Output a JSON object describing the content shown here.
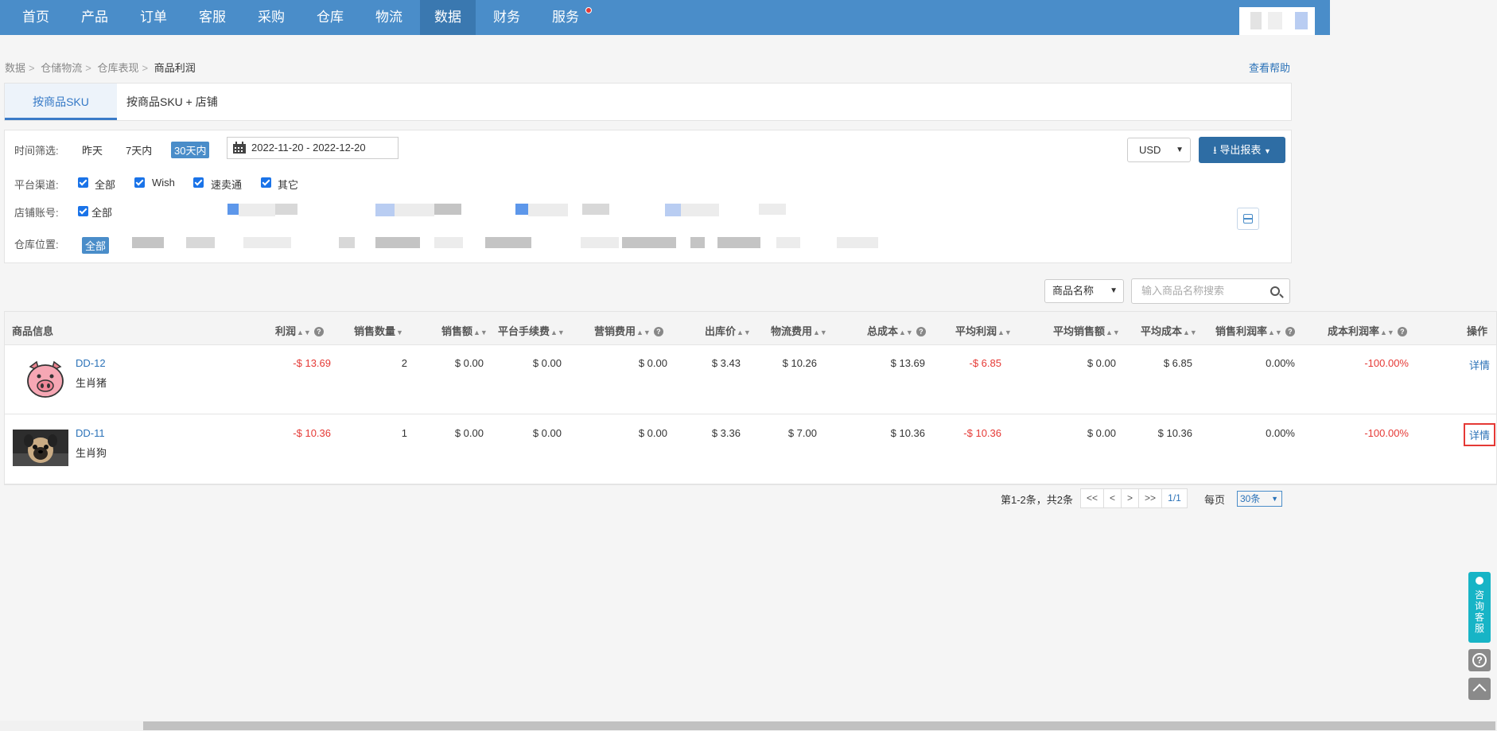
{
  "nav": {
    "items": [
      "首页",
      "产品",
      "订单",
      "客服",
      "采购",
      "仓库",
      "物流",
      "数据",
      "财务",
      "服务"
    ],
    "active": "数据",
    "colors": {
      "bar": "#4a8dc9",
      "active": "#3a78b0",
      "notify_dot": "#e53935"
    }
  },
  "breadcrumb": [
    "数据",
    "仓储物流",
    "仓库表现",
    "商品利润"
  ],
  "help_link": "查看帮助",
  "tabs": [
    "按商品SKU",
    "按商品SKU + 店铺"
  ],
  "filters": {
    "time_label": "时间筛选:",
    "time_options": [
      "昨天",
      "7天内",
      "30天内"
    ],
    "time_selected": "30天内",
    "date_range": "2022-11-20 - 2022-12-20",
    "platform_label": "平台渠道:",
    "platforms": [
      "全部",
      "Wish",
      "速卖通",
      "其它"
    ],
    "store_label": "店铺账号:",
    "store_all": "全部",
    "warehouse_label": "仓库位置:",
    "warehouse_all": "全部"
  },
  "toolbar": {
    "currency": "USD",
    "export_label": "导出报表"
  },
  "search": {
    "field": "商品名称",
    "placeholder": "输入商品名称搜索"
  },
  "table": {
    "headers": [
      "商品信息",
      "利润",
      "销售数量",
      "销售额",
      "平台手续费",
      "营销费用",
      "出库价",
      "物流费用",
      "总成本",
      "平均利润",
      "平均销售额",
      "平均成本",
      "销售利润率",
      "成本利润率",
      "操作"
    ],
    "rows": [
      {
        "sku": "DD-12",
        "name": "生肖猪",
        "profit": "-$ 13.69",
        "qty": "2",
        "sales": "$ 0.00",
        "platform_fee": "$ 0.00",
        "marketing": "$ 0.00",
        "outbound": "$ 3.43",
        "logistics": "$ 10.26",
        "total_cost": "$ 13.69",
        "avg_profit": "-$ 6.85",
        "avg_sales": "$ 0.00",
        "avg_cost": "$ 6.85",
        "sales_margin": "0.00%",
        "cost_margin": "-100.00%",
        "action": "详情"
      },
      {
        "sku": "DD-11",
        "name": "生肖狗",
        "profit": "-$ 10.36",
        "qty": "1",
        "sales": "$ 0.00",
        "platform_fee": "$ 0.00",
        "marketing": "$ 0.00",
        "outbound": "$ 3.36",
        "logistics": "$ 7.00",
        "total_cost": "$ 10.36",
        "avg_profit": "-$ 10.36",
        "avg_sales": "$ 0.00",
        "avg_cost": "$ 10.36",
        "sales_margin": "0.00%",
        "cost_margin": "-100.00%",
        "action": "详情"
      }
    ]
  },
  "pagination": {
    "summary": "第1-2条，共2条",
    "first": "<<",
    "prev": "<",
    "next": ">",
    "last": ">>",
    "page": "1/1",
    "per_page_label": "每页",
    "per_page": "30条"
  },
  "side": {
    "consult": "咨询客服",
    "help_icon": "question-icon",
    "top_icon": "chevron-up-icon"
  }
}
